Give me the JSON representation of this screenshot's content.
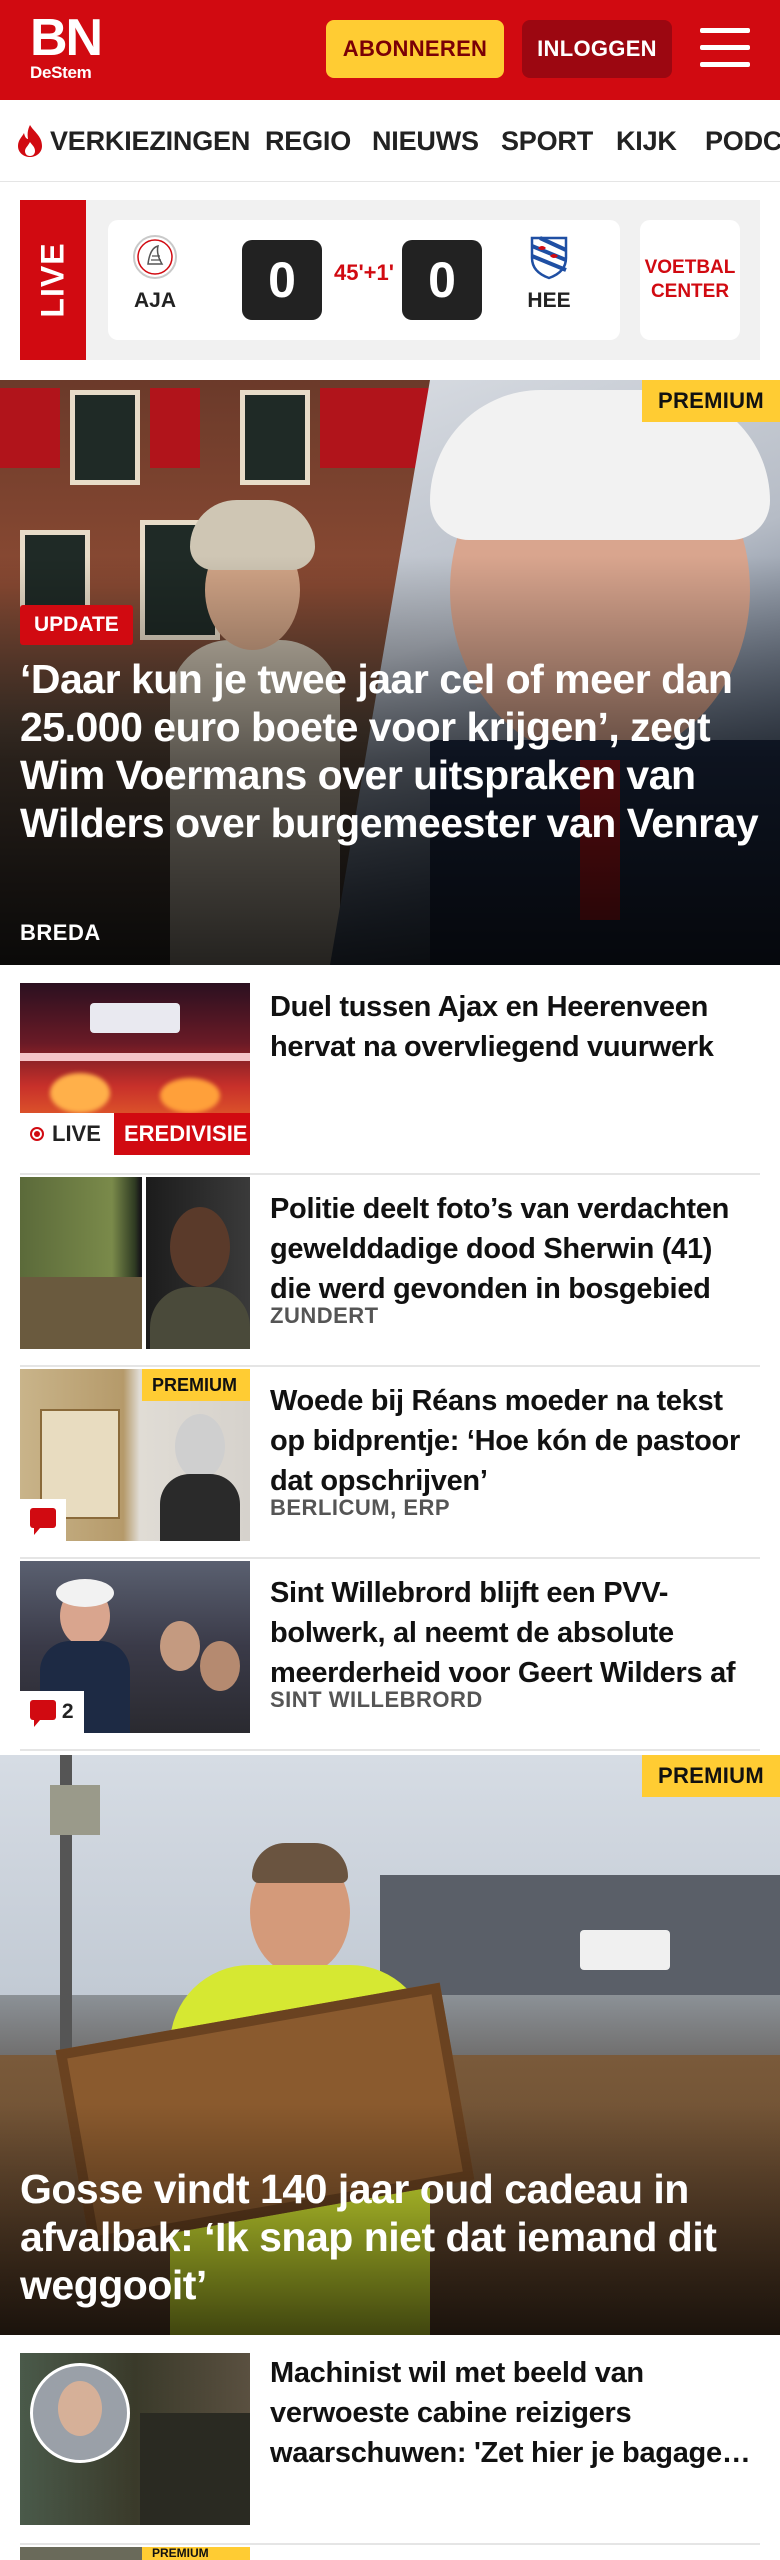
{
  "header": {
    "logo_main": "BN",
    "logo_sub": "DeStem",
    "subscribe_label": "ABONNEREN",
    "login_label": "INLOGGEN",
    "brand_color": "#d10a11",
    "accent_color": "#ffcc33"
  },
  "nav": {
    "items": [
      "VERKIEZINGEN",
      "REGIO",
      "NIEUWS",
      "SPORT",
      "KIJK",
      "PODCASTS"
    ]
  },
  "live": {
    "tab_label": "LIVE",
    "home_abbr": "AJA",
    "away_abbr": "HEE",
    "home_score": "0",
    "away_score": "0",
    "minute": "45'+1'",
    "center_label_1": "VOETBAL",
    "center_label_2": "CENTER"
  },
  "hero": {
    "premium_label": "PREMIUM",
    "badge": "UPDATE",
    "title": "‘Daar kun je twee jaar cel of meer dan 25.000 euro boete voor krijgen’, zegt Wim Voermans over uitspraken van Wilders over burgemeester van Venray",
    "location": "BREDA"
  },
  "articles": [
    {
      "title": "Duel tussen Ajax en Heerenveen hervat na overvliegend vuurwerk",
      "location": "",
      "live_label": "LIVE",
      "category": "EREDIVISIE"
    },
    {
      "title": "Politie deelt foto’s van verdachten gewelddadige dood Sherwin (41) die werd gevonden in bosgebied",
      "location": "ZUNDERT"
    },
    {
      "title": "Woede bij Réans moeder na tekst op bidprentje: ‘Hoe kón de pastoor dat opschrijven’",
      "location": "BERLICUM, ERP",
      "premium_label": "PREMIUM"
    },
    {
      "title": "Sint Willebrord blijft een PVV-bolwerk, al neemt de absolute meerderheid voor Geert Wilders af",
      "location": "SINT WILLEBRORD",
      "comments": "2"
    }
  ],
  "hero2": {
    "premium_label": "PREMIUM",
    "title": "Gosse vindt 140 jaar oud cadeau in afvalbak: ‘Ik snap niet dat iemand dit weggooit’"
  },
  "article_after": {
    "title": "Machinist wil met beeld van verwoeste cabine reizigers waarschuwen: 'Zet hier je bagage niet neer'"
  },
  "article_partial": {
    "premium_label": "PREMIUM"
  }
}
